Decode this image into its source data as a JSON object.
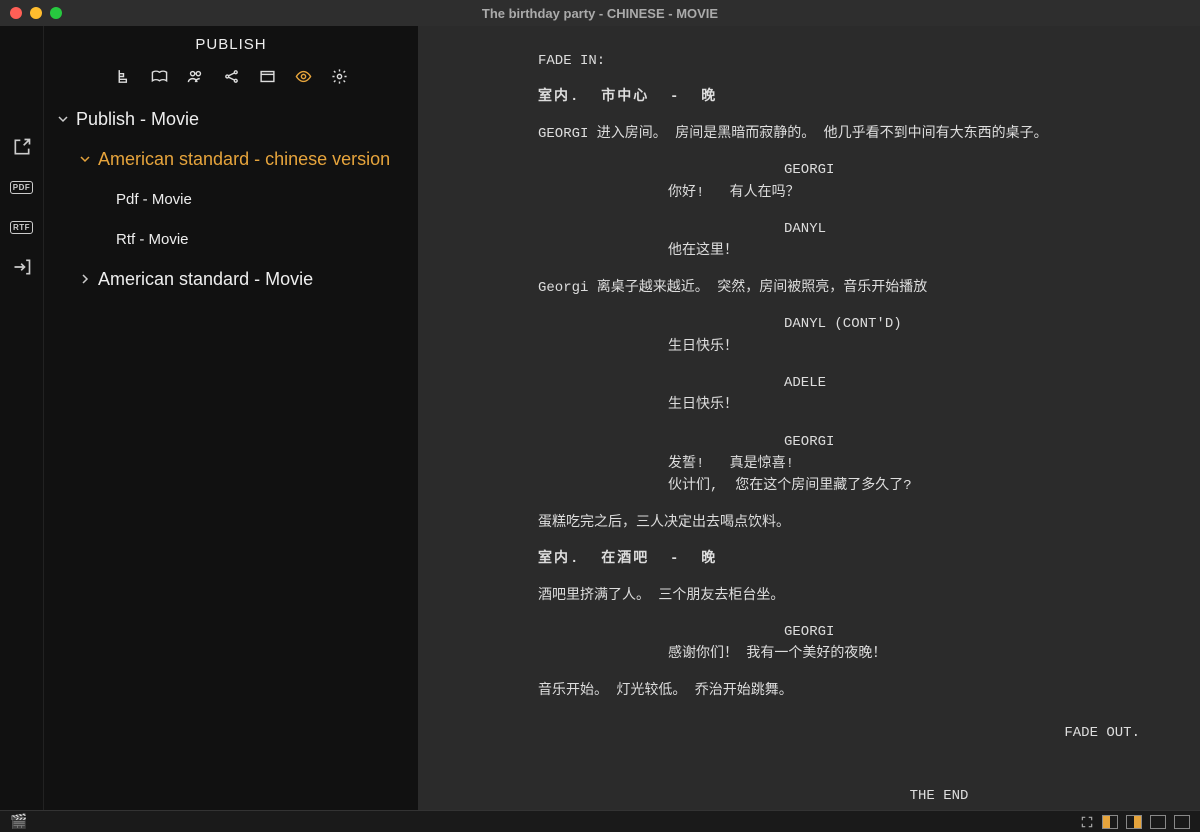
{
  "window": {
    "title": "The birthday party - CHINESE - MOVIE"
  },
  "sidebar": {
    "title": "PUBLISH",
    "tree": {
      "root": "Publish - Movie",
      "items": [
        {
          "label": "American standard - chinese version",
          "selected": true,
          "expanded": true
        },
        {
          "label": "Pdf - Movie"
        },
        {
          "label": "Rtf - Movie"
        },
        {
          "label": "American standard - Movie",
          "expanded": false
        }
      ]
    }
  },
  "script": [
    {
      "t": "trans",
      "text": "FADE IN:"
    },
    {
      "t": "scene",
      "text": "室内.  市中心  -  晚"
    },
    {
      "t": "action",
      "text": "GEORGI 进入房间。 房间是黑暗而寂静的。 他几乎看不到中间有大东西的桌子。"
    },
    {
      "t": "char",
      "text": "GEORGI"
    },
    {
      "t": "dialog",
      "text": "你好!   有人在吗？"
    },
    {
      "t": "char",
      "text": "DANYL"
    },
    {
      "t": "dialog",
      "text": "他在这里！"
    },
    {
      "t": "action",
      "text": "Georgi 离桌子越来越近。 突然，房间被照亮，音乐开始播放"
    },
    {
      "t": "char",
      "text": "DANYL (CONT'D)"
    },
    {
      "t": "dialog",
      "text": "生日快乐！"
    },
    {
      "t": "char",
      "text": "ADELE"
    },
    {
      "t": "dialog",
      "text": "生日快乐！"
    },
    {
      "t": "char",
      "text": "GEORGI"
    },
    {
      "t": "dialog",
      "text": "发誓!   真是惊喜!\n伙计们,  您在这个房间里藏了多久了?"
    },
    {
      "t": "action",
      "text": "蛋糕吃完之后，三人决定出去喝点饮料。"
    },
    {
      "t": "scene",
      "text": "室内.  在酒吧  -  晚"
    },
    {
      "t": "action",
      "text": "酒吧里挤满了人。 三个朋友去柜台坐。"
    },
    {
      "t": "char",
      "text": "GEORGI"
    },
    {
      "t": "dialog",
      "text": "感谢你们！ 我有一个美好的夜晚！"
    },
    {
      "t": "action",
      "text": "音乐开始。 灯光较低。 乔治开始跳舞。"
    },
    {
      "t": "trans-right",
      "text": "FADE OUT."
    },
    {
      "t": "center",
      "text": "THE END"
    }
  ]
}
